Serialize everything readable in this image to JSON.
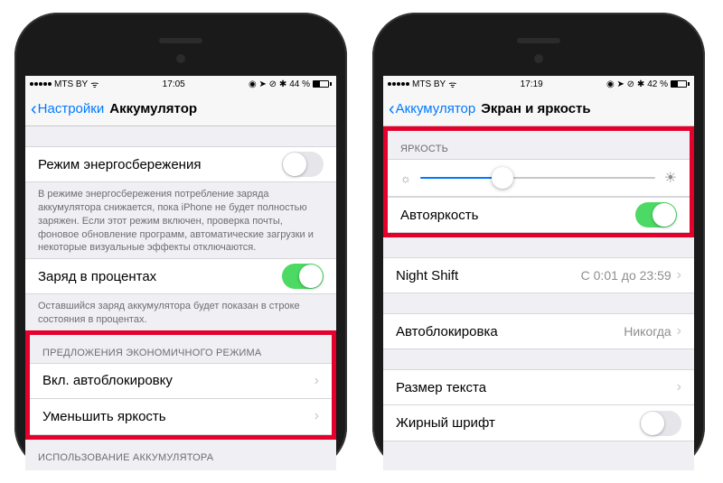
{
  "left": {
    "status": {
      "carrier": "MTS BY",
      "time": "17:05",
      "battery": "44 %"
    },
    "back": "Настройки",
    "title": "Аккумулятор",
    "lowpower": "Режим энергосбережения",
    "lowpower_note": "В режиме энергосбережения потребление заряда аккумулятора снижается, пока iPhone не будет полностью заряжен. Если этот режим включен, проверка почты, фоновое обновление программ, автоматические загрузки и некоторые визуальные эффекты отключаются.",
    "percent": "Заряд в процентах",
    "percent_note": "Оставшийся заряд аккумулятора будет показан в строке состояния в процентах.",
    "suggest_header": "ПРЕДЛОЖЕНИЯ ЭКОНОМИЧНОГО РЕЖИМА",
    "suggest1": "Вкл. автоблокировку",
    "suggest2": "Уменьшить яркость",
    "usage_header": "ИСПОЛЬЗОВАНИЕ АККУМУЛЯТОРА"
  },
  "right": {
    "status": {
      "carrier": "MTS BY",
      "time": "17:19",
      "battery": "42 %"
    },
    "back": "Аккумулятор",
    "title": "Экран и яркость",
    "brightness_header": "ЯРКОСТЬ",
    "autobright": "Автояркость",
    "nightshift": "Night Shift",
    "nightshift_value": "С 0:01 до 23:59",
    "autolock": "Автоблокировка",
    "autolock_value": "Никогда",
    "textsize": "Размер текста",
    "bold": "Жирный шрифт"
  }
}
